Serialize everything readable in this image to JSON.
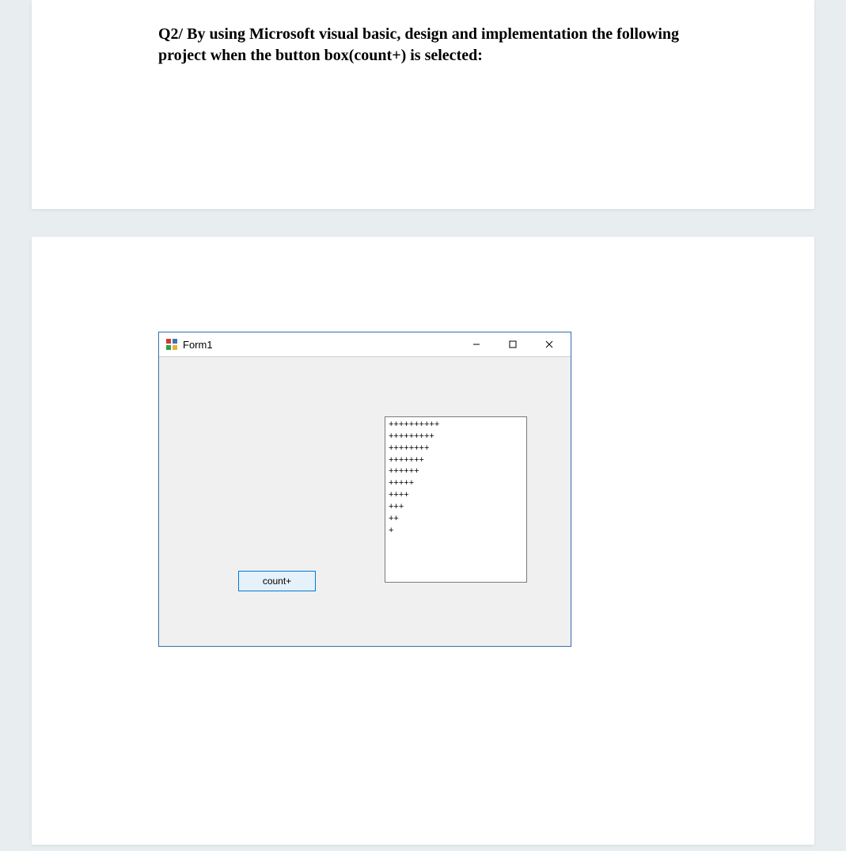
{
  "question": "Q2/ By using Microsoft visual basic, design and implementation the following project when the button box(count+) is selected:",
  "form": {
    "title": "Form1",
    "buttonLabel": "count+",
    "outputLines": [
      "++++++++++",
      "+++++++++",
      "++++++++",
      "+++++++",
      "++++++",
      "+++++",
      "++++",
      "+++",
      "++",
      "+"
    ]
  }
}
